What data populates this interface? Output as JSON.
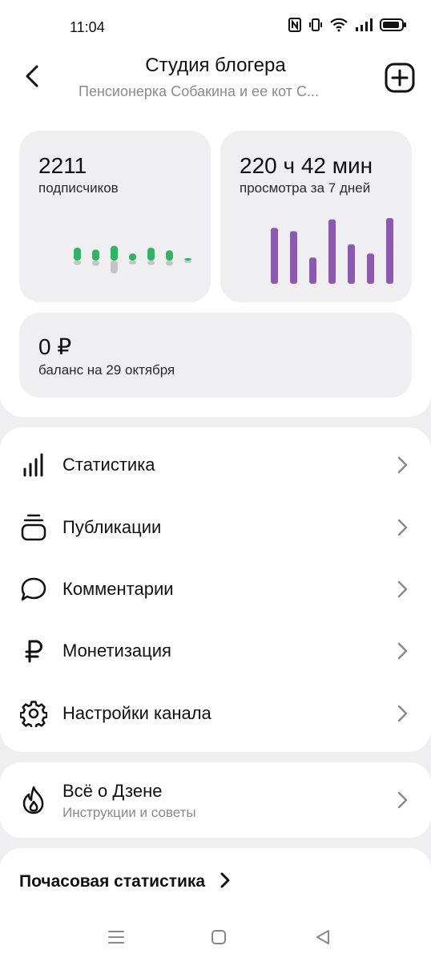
{
  "status": {
    "time": "11:04"
  },
  "header": {
    "title": "Студия блогера",
    "subtitle": "Пенсионерка Собакина и ее кот С..."
  },
  "stats": {
    "subscribers": {
      "value": "2211",
      "label": "подписчиков",
      "bars": [
        {
          "gain": 1.0,
          "loss": 0.35
        },
        {
          "gain": 0.85,
          "loss": 0.4
        },
        {
          "gain": 1.15,
          "loss": 1.0
        },
        {
          "gain": 0.55,
          "loss": 0.3
        },
        {
          "gain": 1.0,
          "loss": 0.35
        },
        {
          "gain": 0.8,
          "loss": 0.4
        },
        {
          "gain": 0.15,
          "loss": 0.15
        }
      ],
      "gain_color": "#2fb463",
      "loss_color": "#c4c4c6"
    },
    "views": {
      "value": "220 ч 42 мин",
      "label": "просмотра за 7 дней",
      "bars": [
        0.85,
        0.8,
        0.4,
        0.98,
        0.6,
        0.46,
        1.0
      ],
      "color": "#8b59b0"
    },
    "balance": {
      "value": "0 ₽",
      "label": "баланс на 29 октября"
    }
  },
  "menu": {
    "items": [
      {
        "label": "Статистика",
        "icon": "bar-chart-icon"
      },
      {
        "label": "Публикации",
        "icon": "publications-stack-icon"
      },
      {
        "label": "Комментарии",
        "icon": "comment-bubble-icon"
      },
      {
        "label": "Монетизация",
        "icon": "ruble-icon"
      },
      {
        "label": "Настройки канала",
        "icon": "gear-icon"
      }
    ]
  },
  "info": {
    "title": "Всё о Дзене",
    "subtitle": "Инструкции и советы",
    "icon": "flame-icon"
  },
  "hourly": {
    "title": "Почасовая статистика"
  },
  "nav": {
    "icons": [
      "menu-lines-icon",
      "home-square-icon",
      "back-triangle-icon"
    ]
  }
}
